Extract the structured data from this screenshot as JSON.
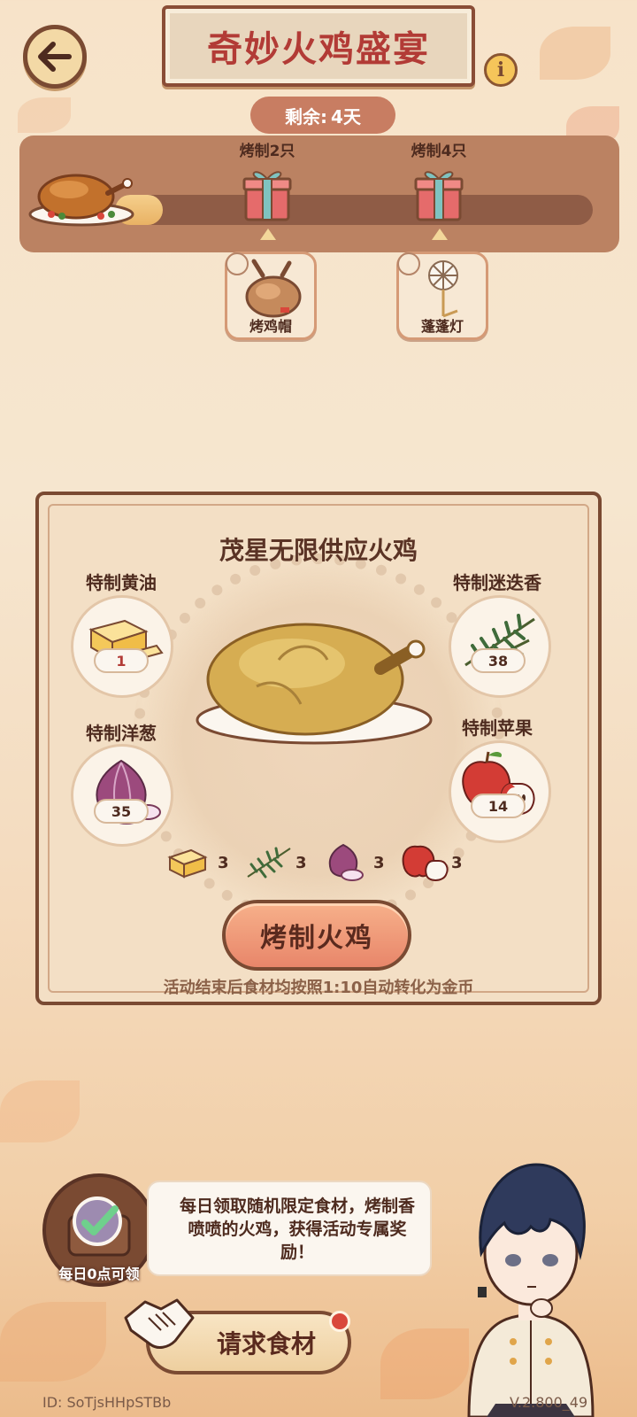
{
  "header": {
    "back_icon": "arrow-left-icon",
    "title": "奇妙火鸡盛宴",
    "info_label": "i",
    "remaining_label": "剩余:",
    "remaining_value": "4天"
  },
  "progress": {
    "fraction": 0.1,
    "milestones": [
      {
        "label": "烤制2只",
        "reward": "烤鸡帽"
      },
      {
        "label": "烤制4只",
        "reward": "蓬蓬灯"
      }
    ]
  },
  "main": {
    "title": "茂星无限供应火鸡",
    "ingredients": [
      {
        "name": "特制黄油",
        "count": "1",
        "cost": "3"
      },
      {
        "name": "特制迷迭香",
        "count": "38",
        "cost": "3"
      },
      {
        "name": "特制洋葱",
        "count": "35",
        "cost": "3"
      },
      {
        "name": "特制苹果",
        "count": "14",
        "cost": "3"
      }
    ],
    "roast_button": "烤制火鸡",
    "note": "活动结束后食材均按照1:10自动转化为金币"
  },
  "bottom": {
    "daily_label": "每日0点可领",
    "bubble_text": "每日领取随机限定食材，烤制香喷喷的火鸡，获得活动专属奖励！",
    "request_button": "请求食材",
    "user_id": "ID: SoTjsHHpSTBb",
    "version": "V.2.800_49"
  },
  "colors": {
    "accent": "#b23b36",
    "border": "#7a4a32",
    "panel": "#bb8262"
  }
}
